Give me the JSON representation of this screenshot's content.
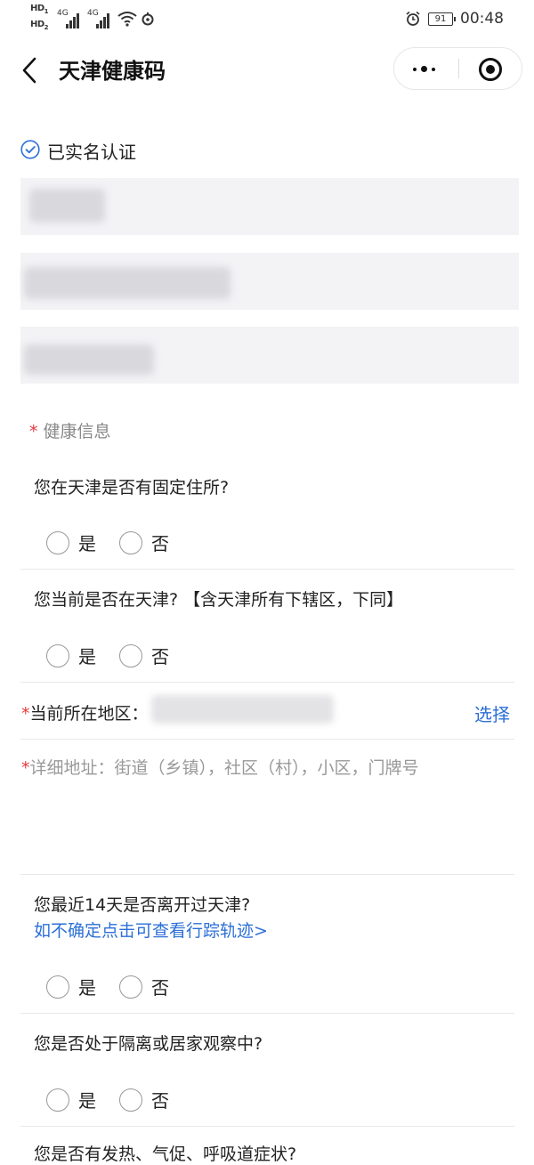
{
  "status_bar": {
    "hd1": "HD",
    "hd1_sub": "1",
    "hd2": "HD",
    "hd2_sub": "2",
    "net1": "4G",
    "net2": "4G",
    "battery": "91",
    "time": "00:48"
  },
  "header": {
    "title": "天津健康码"
  },
  "verified": {
    "label": "已实名认证"
  },
  "form": {
    "section_required_mark": "*",
    "section_label": "健康信息",
    "yes_label": "是",
    "no_label": "否",
    "questions": [
      {
        "text": "您在天津是否有固定住所?"
      },
      {
        "text": "您当前是否在天津? 【含天津所有下辖区，下同】"
      },
      {
        "text": "您最近14天是否离开过天津?",
        "link": "如不确定点击可查看行踪轨迹>"
      },
      {
        "text": "您是否处于隔离或居家观察中?"
      },
      {
        "text": "您是否有发热、气促、呼吸道症状?"
      }
    ],
    "region": {
      "required_mark": "*",
      "label": "当前所在地区：",
      "action": "选择"
    },
    "address": {
      "required_mark": "*",
      "placeholder": "详细地址：街道（乡镇），社区（村），小区，门牌号"
    }
  }
}
